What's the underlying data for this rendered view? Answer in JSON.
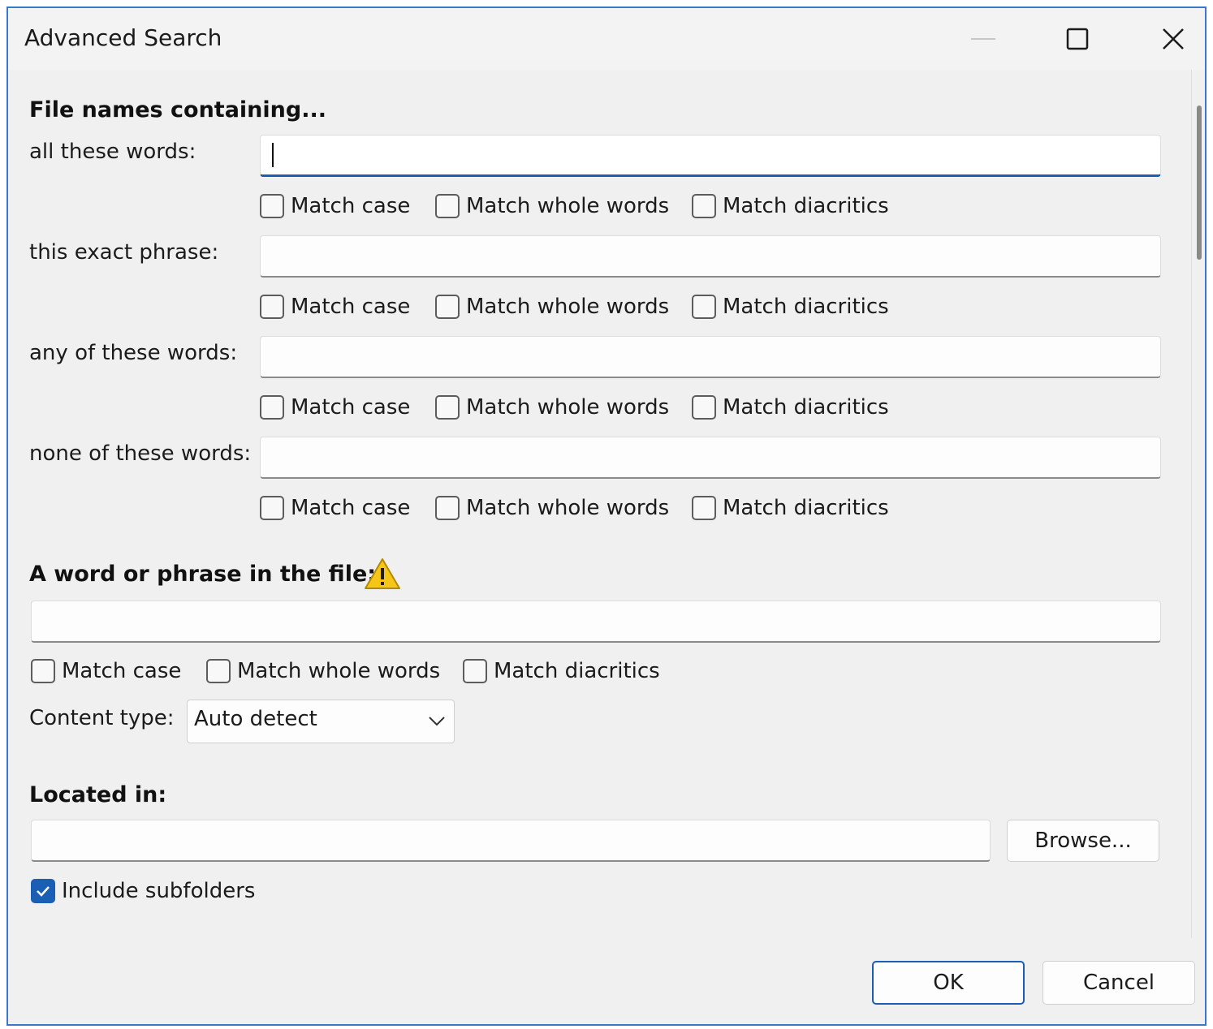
{
  "window": {
    "title": "Advanced Search"
  },
  "filenames": {
    "heading": "File names containing...",
    "rows": [
      {
        "label": "all these words:",
        "value": "",
        "options": [
          "Match case",
          "Match whole words",
          "Match diacritics"
        ],
        "checked": [
          false,
          false,
          false
        ]
      },
      {
        "label": "this exact phrase:",
        "value": "",
        "options": [
          "Match case",
          "Match whole words",
          "Match diacritics"
        ],
        "checked": [
          false,
          false,
          false
        ]
      },
      {
        "label": "any of these words:",
        "value": "",
        "options": [
          "Match case",
          "Match whole words",
          "Match diacritics"
        ],
        "checked": [
          false,
          false,
          false
        ]
      },
      {
        "label": "none of these words:",
        "value": "",
        "options": [
          "Match case",
          "Match whole words",
          "Match diacritics"
        ],
        "checked": [
          false,
          false,
          false
        ]
      }
    ]
  },
  "content": {
    "heading": "A word or phrase in the file:",
    "warning_icon": "warning-icon",
    "value": "",
    "options": [
      "Match case",
      "Match whole words",
      "Match diacritics"
    ],
    "checked": [
      false,
      false,
      false
    ],
    "type_label": "Content type:",
    "type_value": "Auto detect"
  },
  "location": {
    "heading": "Located in:",
    "value": "",
    "browse_label": "Browse...",
    "include_subfolders_label": "Include subfolders",
    "include_subfolders_checked": true
  },
  "footer": {
    "ok_label": "OK",
    "cancel_label": "Cancel"
  },
  "colors": {
    "accent": "#1a5fb4",
    "warning": "#f5c518"
  }
}
